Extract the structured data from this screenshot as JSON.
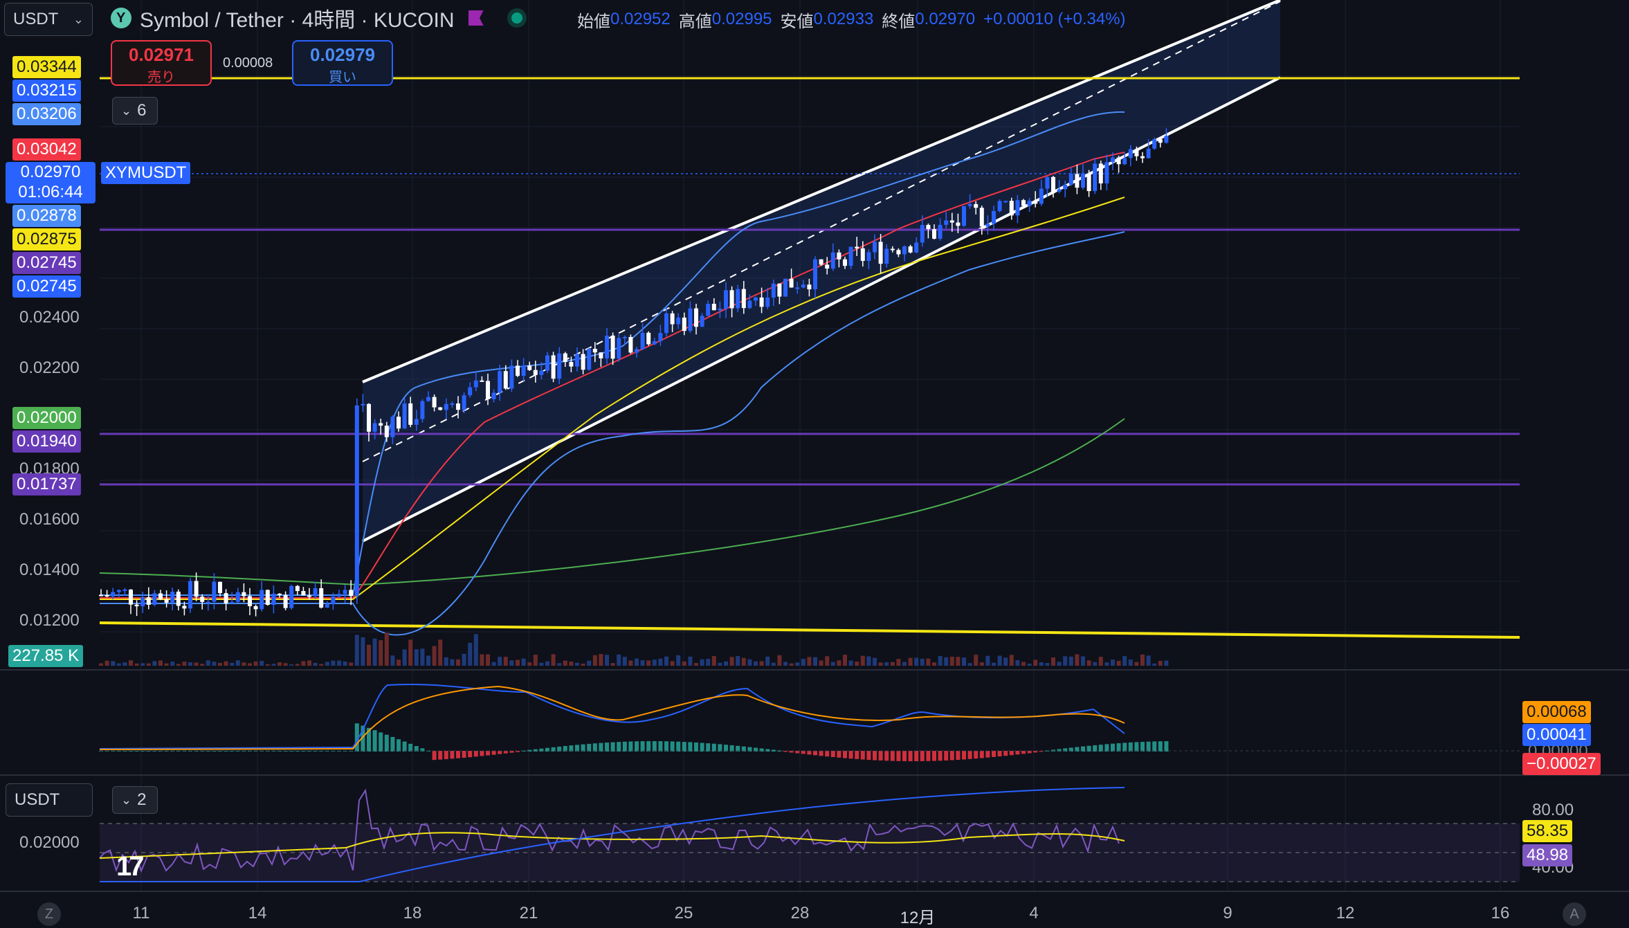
{
  "header": {
    "currency_select": "USDT",
    "title": "Symbol / Tether · 4時間 · KUCOIN",
    "ohlc": [
      {
        "k": "始値",
        "v": "0.02952"
      },
      {
        "k": "高値",
        "v": "0.02995"
      },
      {
        "k": "安値",
        "v": "0.02933"
      },
      {
        "k": "終値",
        "v": "0.02970"
      }
    ],
    "change": "+0.00010 (+0.34%)",
    "colors": {
      "accent": "#2962ff",
      "up": "#2962ff",
      "down": "#ffffff"
    }
  },
  "trade": {
    "sell_price": "0.02971",
    "sell_label": "売り",
    "spread": "0.00008",
    "buy_price": "0.02979",
    "buy_label": "買い",
    "indicators_toggle": "6"
  },
  "symbol_label": "XYMUSDT",
  "price_axis": {
    "ticks": [
      "0.02400",
      "0.02200",
      "0.01800",
      "0.01600",
      "0.01400",
      "0.01200"
    ],
    "tags": [
      {
        "text": "0.03344",
        "bg": "#f5e514",
        "fg": "#131722"
      },
      {
        "text": "0.03215",
        "bg": "#2962ff",
        "fg": "#ffffff"
      },
      {
        "text": "0.03206",
        "bg": "#4a8cf7",
        "fg": "#ffffff"
      },
      {
        "text": "0.03042",
        "bg": "#f23645",
        "fg": "#ffffff"
      },
      {
        "text": "0.02970",
        "bg": "#2962ff",
        "fg": "#ffffff"
      },
      {
        "text": "01:06:44",
        "bg": "#2962ff",
        "fg": "#ffffff"
      },
      {
        "text": "0.02878",
        "bg": "#4a8cf7",
        "fg": "#ffffff"
      },
      {
        "text": "0.02875",
        "bg": "#f5e514",
        "fg": "#131722"
      },
      {
        "text": "0.02745",
        "bg": "#673ab7",
        "fg": "#ffffff"
      },
      {
        "text": "0.02745",
        "bg": "#2962ff",
        "fg": "#ffffff"
      },
      {
        "text": "0.02000",
        "bg": "#4caf50",
        "fg": "#ffffff"
      },
      {
        "text": "0.01940",
        "bg": "#673ab7",
        "fg": "#ffffff"
      },
      {
        "text": "0.01737",
        "bg": "#673ab7",
        "fg": "#ffffff"
      },
      {
        "text": "227.85 K",
        "bg": "#26a69a",
        "fg": "#ffffff"
      }
    ]
  },
  "macd_panel": {
    "tags": [
      {
        "text": "0.00068",
        "bg": "#ff9800",
        "fg": "#131722"
      },
      {
        "text": "0.00041",
        "bg": "#2962ff",
        "fg": "#ffffff"
      },
      {
        "text": "−0.00027",
        "bg": "#f23645",
        "fg": "#ffffff"
      }
    ],
    "zero_label": "0.00000"
  },
  "rsi_panel": {
    "currency_select": "USDT",
    "toggle": "2",
    "price_tick": "0.02000",
    "ticks": [
      "80.00",
      "40.00"
    ],
    "tags": [
      {
        "text": "58.35",
        "bg": "#f5e514",
        "fg": "#131722"
      },
      {
        "text": "48.98",
        "bg": "#7e57c2",
        "fg": "#ffffff"
      }
    ]
  },
  "time_axis": [
    "11",
    "14",
    "18",
    "21",
    "25",
    "28",
    "12月",
    "4",
    "9",
    "12",
    "16"
  ],
  "corner_labels": {
    "left": "Z",
    "right": "A"
  }
}
